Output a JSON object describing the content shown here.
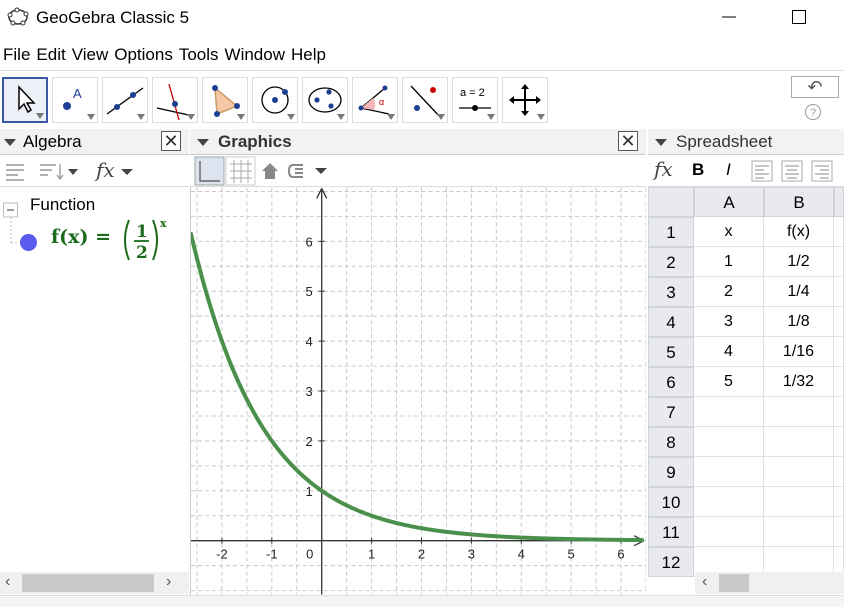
{
  "window": {
    "title": "GeoGebra Classic 5",
    "app_icon": "geogebra-logo-icon",
    "minimize_glyph": "—",
    "maximize_glyph": "☐"
  },
  "menu": [
    "File",
    "Edit",
    "View",
    "Options",
    "Tools",
    "Window",
    "Help"
  ],
  "toolbar": {
    "tools": [
      "move-icon",
      "point-icon",
      "line-icon",
      "perpendicular-line-icon",
      "polygon-icon",
      "circle-icon",
      "ellipse-icon",
      "angle-icon",
      "reflect-icon",
      "slider-icon",
      "move-graphics-icon"
    ],
    "slider_text": "a = 2",
    "point_label": "A",
    "undo_glyph": "↶",
    "help_glyph": "?"
  },
  "algebra": {
    "title": "Algebra",
    "group_label": "Function",
    "expr_name": "f(x) =",
    "expr_base_num": "1",
    "expr_base_den": "2",
    "expr_exponent": "x",
    "fx_button": "fx",
    "object_color": "#5b5bf0"
  },
  "graphics": {
    "title": "Graphics",
    "curve_color": "#4a8f4a",
    "x_ticks": [
      "-2",
      "-1",
      "0",
      "1",
      "2",
      "3",
      "4",
      "5",
      "6"
    ],
    "y_ticks": [
      "1",
      "2",
      "3",
      "4",
      "5",
      "6"
    ]
  },
  "spreadsheet": {
    "title": "Spreadsheet",
    "fx_button": "fx",
    "bold": "B",
    "italic": "I",
    "columns": [
      "A",
      "B"
    ],
    "rows": [
      "1",
      "2",
      "3",
      "4",
      "5",
      "6",
      "7",
      "8",
      "9",
      "10",
      "11",
      "12"
    ],
    "cells": [
      [
        "x",
        "f(x)"
      ],
      [
        "1",
        "1/2"
      ],
      [
        "2",
        "1/4"
      ],
      [
        "3",
        "1/8"
      ],
      [
        "4",
        "1/16"
      ],
      [
        "5",
        "1/32"
      ],
      [
        "",
        ""
      ],
      [
        "",
        ""
      ],
      [
        "",
        ""
      ],
      [
        "",
        ""
      ],
      [
        "",
        ""
      ],
      [
        "",
        ""
      ]
    ]
  }
}
